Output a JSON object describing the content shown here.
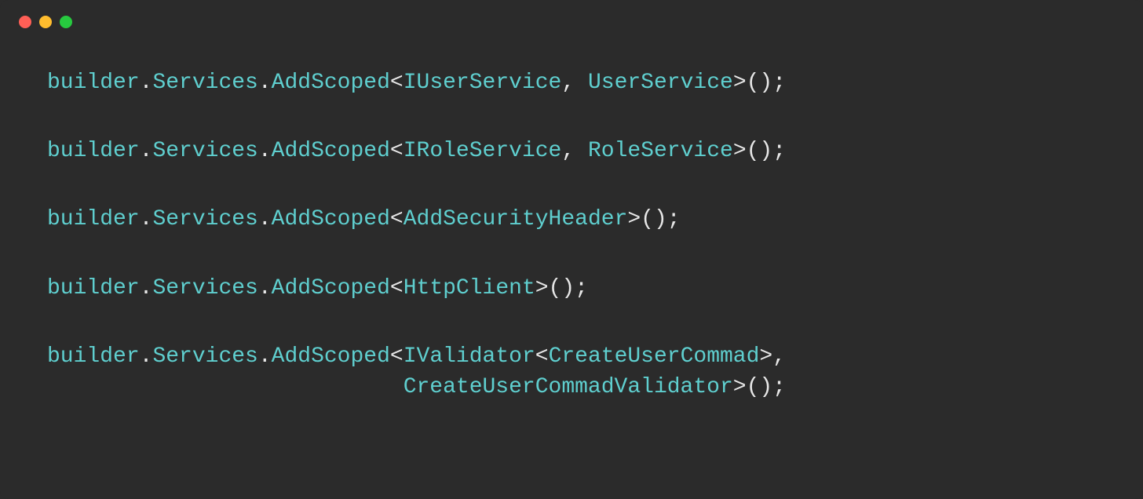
{
  "window": {
    "traffic_lights": {
      "red": "#ff5f56",
      "yellow": "#ffbd2e",
      "green": "#27c93f"
    }
  },
  "code": {
    "lines": [
      {
        "segments": [
          {
            "text": "builder",
            "class": "teal"
          },
          {
            "text": ".",
            "class": "white"
          },
          {
            "text": "Services",
            "class": "teal"
          },
          {
            "text": ".",
            "class": "white"
          },
          {
            "text": "AddScoped",
            "class": "teal"
          },
          {
            "text": "<",
            "class": "white"
          },
          {
            "text": "IUserService",
            "class": "teal"
          },
          {
            "text": ", ",
            "class": "white"
          },
          {
            "text": "UserService",
            "class": "teal"
          },
          {
            "text": ">();",
            "class": "white"
          }
        ]
      },
      {
        "segments": [
          {
            "text": "builder",
            "class": "teal"
          },
          {
            "text": ".",
            "class": "white"
          },
          {
            "text": "Services",
            "class": "teal"
          },
          {
            "text": ".",
            "class": "white"
          },
          {
            "text": "AddScoped",
            "class": "teal"
          },
          {
            "text": "<",
            "class": "white"
          },
          {
            "text": "IRoleService",
            "class": "teal"
          },
          {
            "text": ", ",
            "class": "white"
          },
          {
            "text": "RoleService",
            "class": "teal"
          },
          {
            "text": ">();",
            "class": "white"
          }
        ]
      },
      {
        "segments": [
          {
            "text": "builder",
            "class": "teal"
          },
          {
            "text": ".",
            "class": "white"
          },
          {
            "text": "Services",
            "class": "teal"
          },
          {
            "text": ".",
            "class": "white"
          },
          {
            "text": "AddScoped",
            "class": "teal"
          },
          {
            "text": "<",
            "class": "white"
          },
          {
            "text": "AddSecurityHeader",
            "class": "teal"
          },
          {
            "text": ">();",
            "class": "white"
          }
        ]
      },
      {
        "segments": [
          {
            "text": "builder",
            "class": "teal"
          },
          {
            "text": ".",
            "class": "white"
          },
          {
            "text": "Services",
            "class": "teal"
          },
          {
            "text": ".",
            "class": "white"
          },
          {
            "text": "AddScoped",
            "class": "teal"
          },
          {
            "text": "<",
            "class": "white"
          },
          {
            "text": "HttpClient",
            "class": "teal"
          },
          {
            "text": ">();",
            "class": "white"
          }
        ]
      },
      {
        "segments": [
          {
            "text": "builder",
            "class": "teal"
          },
          {
            "text": ".",
            "class": "white"
          },
          {
            "text": "Services",
            "class": "teal"
          },
          {
            "text": ".",
            "class": "white"
          },
          {
            "text": "AddScoped",
            "class": "teal"
          },
          {
            "text": "<",
            "class": "white"
          },
          {
            "text": "IValidator",
            "class": "teal"
          },
          {
            "text": "<",
            "class": "white"
          },
          {
            "text": "CreateUserCommad",
            "class": "teal"
          },
          {
            "text": ">,",
            "class": "white"
          }
        ],
        "continuation": [
          {
            "text": "                           ",
            "class": "white"
          },
          {
            "text": "CreateUserCommadValidator",
            "class": "teal"
          },
          {
            "text": ">();",
            "class": "white"
          }
        ]
      }
    ]
  }
}
